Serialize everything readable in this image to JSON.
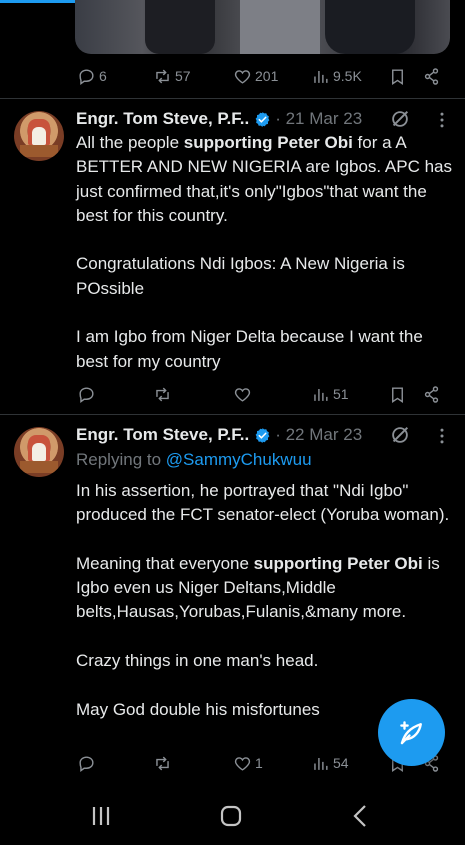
{
  "top_tweet": {
    "actions": {
      "replies": "6",
      "reposts": "57",
      "likes": "201",
      "views": "9.5K"
    }
  },
  "tweets": [
    {
      "author": "Engr. Tom Steve, P.F..",
      "date": "· 21 Mar 23",
      "text_parts": [
        "All the people ",
        "supporting Peter Obi",
        " for a A BETTER AND NEW NIGERIA are Igbos. APC has just confirmed that,it's only\"Igbos\"that want the  best for this country.\n\nCongratulations Ndi Igbos: A New Nigeria is POssible\n\nI am Igbo from Niger Delta because I want the best for my country"
      ],
      "actions": {
        "replies": "",
        "reposts": "",
        "likes": "",
        "views": "51"
      }
    },
    {
      "author": "Engr. Tom Steve, P.F..",
      "date": "· 22 Mar 23",
      "replying_label": "Replying to ",
      "replying_handle": "@SammyChukwuu",
      "text_parts": [
        "In his assertion, he portrayed that \"Ndi Igbo\" produced the FCT senator-elect (Yoruba woman).\n\nMeaning that everyone ",
        "supporting Peter Obi",
        " is Igbo even us Niger Deltans,Middle belts,Hausas,Yorubas,Fulanis,&many more.\n\nCrazy things in one man's head.\n\nMay God double his misfortunes"
      ],
      "actions": {
        "replies": "",
        "reposts": "",
        "likes": "1",
        "views": "54"
      }
    }
  ],
  "colors": {
    "background": "#000000",
    "accent": "#1d9bf0",
    "text": "#e7e9ea",
    "muted": "#71767b",
    "divider": "#2f3336"
  },
  "icons": [
    "reply-icon",
    "repost-icon",
    "like-icon",
    "views-icon",
    "bookmark-icon",
    "share-icon",
    "verified-icon",
    "grok-icon",
    "more-icon",
    "compose-icon",
    "recents-icon",
    "home-icon",
    "back-icon"
  ]
}
